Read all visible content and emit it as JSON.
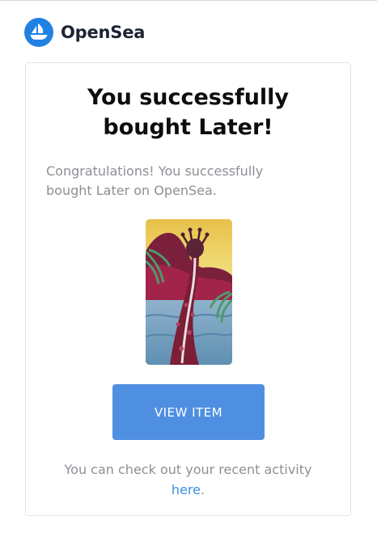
{
  "brand": {
    "name": "OpenSea",
    "logo_icon": "opensea-sailboat-icon",
    "logo_color": "#2081e2"
  },
  "card": {
    "title_line1": "You successfully",
    "title_line2": "bought Later!",
    "message_line1": "Congratulations! You successfully",
    "message_line2": "bought Later on OpenSea.",
    "button_label": "VIEW ITEM",
    "button_color": "#4f8fe2",
    "footer_text": "You can check out your recent activity",
    "footer_link": "here",
    "footer_suffix": "."
  }
}
